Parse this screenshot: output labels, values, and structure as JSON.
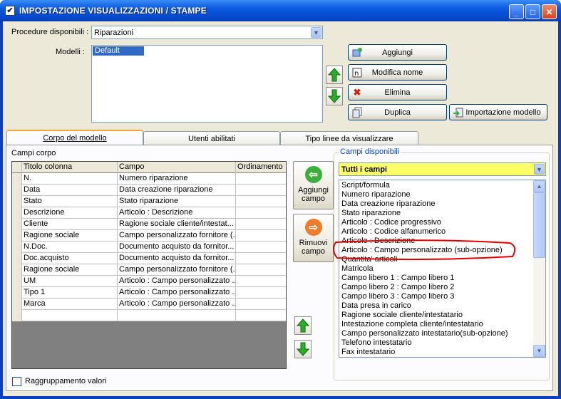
{
  "window": {
    "title": "IMPOSTAZIONE VISUALIZZAZIONI / STAMPE",
    "minimize": "_",
    "maximize": "□",
    "close": "✕"
  },
  "procedure": {
    "label": "Procedure disponibili :",
    "value": "Riparazioni"
  },
  "modelli": {
    "label": "Modelli :",
    "items": [
      "Default"
    ],
    "selected": "Default"
  },
  "buttons": {
    "aggiungi": "Aggiungi",
    "modifica_nome": "Modifica nome",
    "elimina": "Elimina",
    "duplica": "Duplica",
    "importazione": "Importazione modello"
  },
  "tabs": [
    {
      "label": "Corpo del modello",
      "active": true
    },
    {
      "label": "Utenti abilitati",
      "active": false
    },
    {
      "label": "Tipo linee da visualizzare",
      "active": false
    }
  ],
  "campi_corpo": {
    "label": "Campi corpo",
    "columns": [
      "Titolo colonna",
      "Campo",
      "Ordinamento"
    ],
    "rows": [
      [
        "N.",
        "Numero riparazione",
        ""
      ],
      [
        "Data",
        "Data creazione riparazione",
        ""
      ],
      [
        "Stato",
        "Stato riparazione",
        ""
      ],
      [
        "Descrizione",
        "Articolo : Descrizione",
        ""
      ],
      [
        "Cliente",
        "Ragione sociale cliente/intestat...",
        ""
      ],
      [
        "Ragione sociale",
        "Campo personalizzato fornitore (...",
        ""
      ],
      [
        "N.Doc.",
        "Documento acquisto da fornitor...",
        ""
      ],
      [
        "Doc.acquisto",
        "Documento acquisto da fornitor...",
        ""
      ],
      [
        "Ragione sociale",
        "Campo personalizzato fornitore (...",
        ""
      ],
      [
        "UM",
        "Articolo : Campo personalizzato ...",
        ""
      ],
      [
        "Tipo 1",
        "Articolo : Campo personalizzato ...",
        ""
      ],
      [
        "Marca",
        "Articolo : Campo personalizzato ...",
        ""
      ],
      [
        "",
        "",
        ""
      ]
    ]
  },
  "actions": {
    "aggiungi_campo": [
      "Aggiungi",
      "campo"
    ],
    "rimuovi_campo": [
      "Rimuovi",
      "campo"
    ]
  },
  "campi_disponibili": {
    "label": "Campi disponibili",
    "filter": "Tutti i campi",
    "items": [
      "Script/formula",
      "Numero riparazione",
      "Data creazione riparazione",
      "Stato riparazione",
      "Articolo : Codice progressivo",
      "Articolo : Codice alfanumerico",
      "Articolo : Descrizione",
      "Articolo : Campo personalizzato (sub-opzione)",
      "Quantita' articoli",
      "Matricola",
      "Campo libero 1 : Campo libero 1",
      "Campo libero 2 : Campo libero 2",
      "Campo libero 3 : Campo libero 3",
      "Data presa in carico",
      "Ragione sociale cliente/intestatario",
      "Intestazione completa cliente/intestatario",
      "Campo personalizzato intestatario(sub-opzione)",
      "Telefono intestatario",
      "Fax intestatario"
    ],
    "highlight_color": "#e00000"
  },
  "raggruppamento": {
    "label": "Raggruppamento valori",
    "checked": false
  },
  "colors": {
    "titlebar": "#0a5ae0",
    "face": "#ece9d8",
    "selection": "#316ac5",
    "filter_bg": "#ffff66",
    "arrow_green": "#1e9a1e",
    "circle_green": "#3cae3c",
    "circle_orange": "#f07b2a"
  }
}
